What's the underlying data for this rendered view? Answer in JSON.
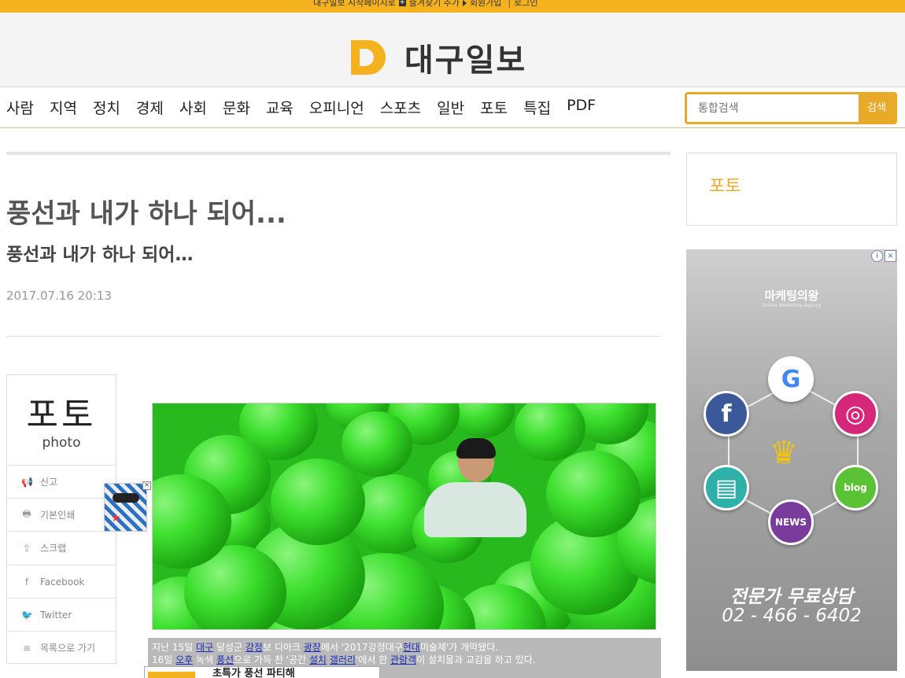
{
  "topbar": {
    "set_homepage": "대구일보 시작페이지로",
    "add_favorite": "즐겨찾기 추가",
    "signup": "회원가입",
    "separator": "|",
    "login": "로그인"
  },
  "brand": {
    "logo_letter": "D",
    "name": "대구일보",
    "accent": "#f4b21f"
  },
  "nav": {
    "items": [
      "사람",
      "지역",
      "정치",
      "경제",
      "사회",
      "문화",
      "교육",
      "오피니언",
      "스포츠",
      "일반",
      "포토",
      "특집",
      "PDF"
    ]
  },
  "search": {
    "placeholder": "통합검색",
    "button": "검색"
  },
  "article": {
    "headline": "풍선과 내가 하나 되어...",
    "subheadline": "풍선과 내가 하나 되어…",
    "date": "2017.07.16 20:13",
    "caption_line1": [
      "지난 15일 ",
      "대구",
      " 달성군 ",
      "강정",
      "보 디아크 ",
      "광장",
      "에서 '2017강정대구",
      "현대",
      "미술제'가 개막됐다."
    ],
    "caption_line2": [
      "16일 ",
      "오후",
      " 녹색 ",
      "풍선",
      "으로 가득 찬 '공간 ",
      "설치",
      " ",
      "갤러리",
      "'에서 한 ",
      "관람객",
      "이 설치물과 교감을 하고 있다."
    ],
    "popup_text": "초특가 풍선 파티해"
  },
  "share": {
    "category_ko": "포토",
    "category_en": "photo",
    "actions": [
      {
        "icon": "megaphone-icon",
        "glyph": "📢",
        "label": "신고"
      },
      {
        "icon": "printer-icon",
        "glyph": "🖶",
        "label": "기본인쇄"
      },
      {
        "icon": "share-icon",
        "glyph": "⇪",
        "label": "스크랩"
      },
      {
        "icon": "facebook-icon",
        "glyph": "f",
        "label": "Facebook"
      },
      {
        "icon": "twitter-icon",
        "glyph": "🐦",
        "label": "Twitter"
      },
      {
        "icon": "list-icon",
        "glyph": "≡",
        "label": "목록으로 가기"
      }
    ]
  },
  "sidebar": {
    "section_label": "포토"
  },
  "ad": {
    "brand": "마케팅의왕",
    "brand_sub": "Online Marketing Agency",
    "cta_line1": "전문가 무료상담",
    "cta_line2": "02 - 466 - 6402",
    "nodes": [
      {
        "name": "google-icon",
        "text": "G",
        "color": "#ffffff",
        "text_color": "#4285f4"
      },
      {
        "name": "facebook-logo-icon",
        "text": "f",
        "color": "#3b5998",
        "text_color": "#ffffff"
      },
      {
        "name": "instagram-icon",
        "text": "◎",
        "color": "#d6287a",
        "text_color": "#ffffff"
      },
      {
        "name": "newspaper-icon",
        "text": "▤",
        "color": "#2fb0a8",
        "text_color": "#ffffff"
      },
      {
        "name": "blog-icon",
        "text": "blog",
        "color": "#5bc236",
        "text_color": "#ffffff"
      },
      {
        "name": "news-icon",
        "text": "NEWS",
        "color": "#7a3c9c",
        "text_color": "#ffffff"
      }
    ]
  }
}
